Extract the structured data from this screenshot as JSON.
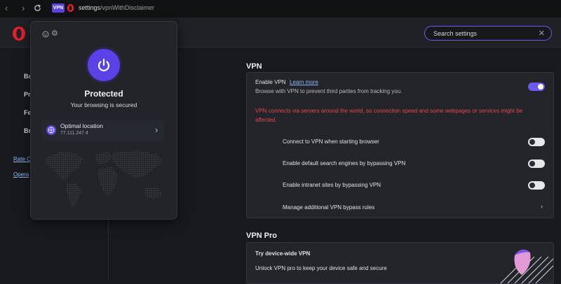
{
  "topbar": {
    "back_icon": "back-icon",
    "forward_icon": "forward-icon",
    "reload_icon": "reload-icon",
    "vpn_badge": "VPN",
    "url_host": "settings",
    "url_path": "/vpnWithDisclaimer"
  },
  "search": {
    "placeholder": "Search settings",
    "clear_icon": "close-icon"
  },
  "sidebar": {
    "items": [
      "Ba",
      "Pr",
      "Fe",
      "Br"
    ],
    "links": [
      "Rate C",
      "Opera"
    ]
  },
  "vpn": {
    "title": "VPN",
    "enable_label": "Enable VPN",
    "learn_more": "Learn more",
    "enable_desc": "Browse with VPN to prevent third parties from tracking you.",
    "enable_on": true,
    "warning_line1": "VPN connects via servers around the world, so connection speed and some webpages or services might be",
    "warning_line2": "affected.",
    "options": [
      {
        "label": "Connect to VPN when starting browser",
        "on": false
      },
      {
        "label": "Enable default search engines by bypassing VPN",
        "on": false
      },
      {
        "label": "Enable intranet sites by bypassing VPN",
        "on": false
      }
    ],
    "manage_label": "Manage additional VPN bypass rules"
  },
  "vpn_pro": {
    "title": "VPN Pro",
    "card_title": "Try device-wide VPN",
    "card_desc": "Unlock VPN pro to keep your device safe and secure"
  },
  "popup": {
    "status": "Protected",
    "substatus": "Your browsing is secured",
    "location_label": "Optimal location",
    "ip": "77.111.247.4"
  },
  "colors": {
    "accent": "#6a5af5",
    "warning": "#e5484d",
    "link": "#8fb9f1"
  }
}
